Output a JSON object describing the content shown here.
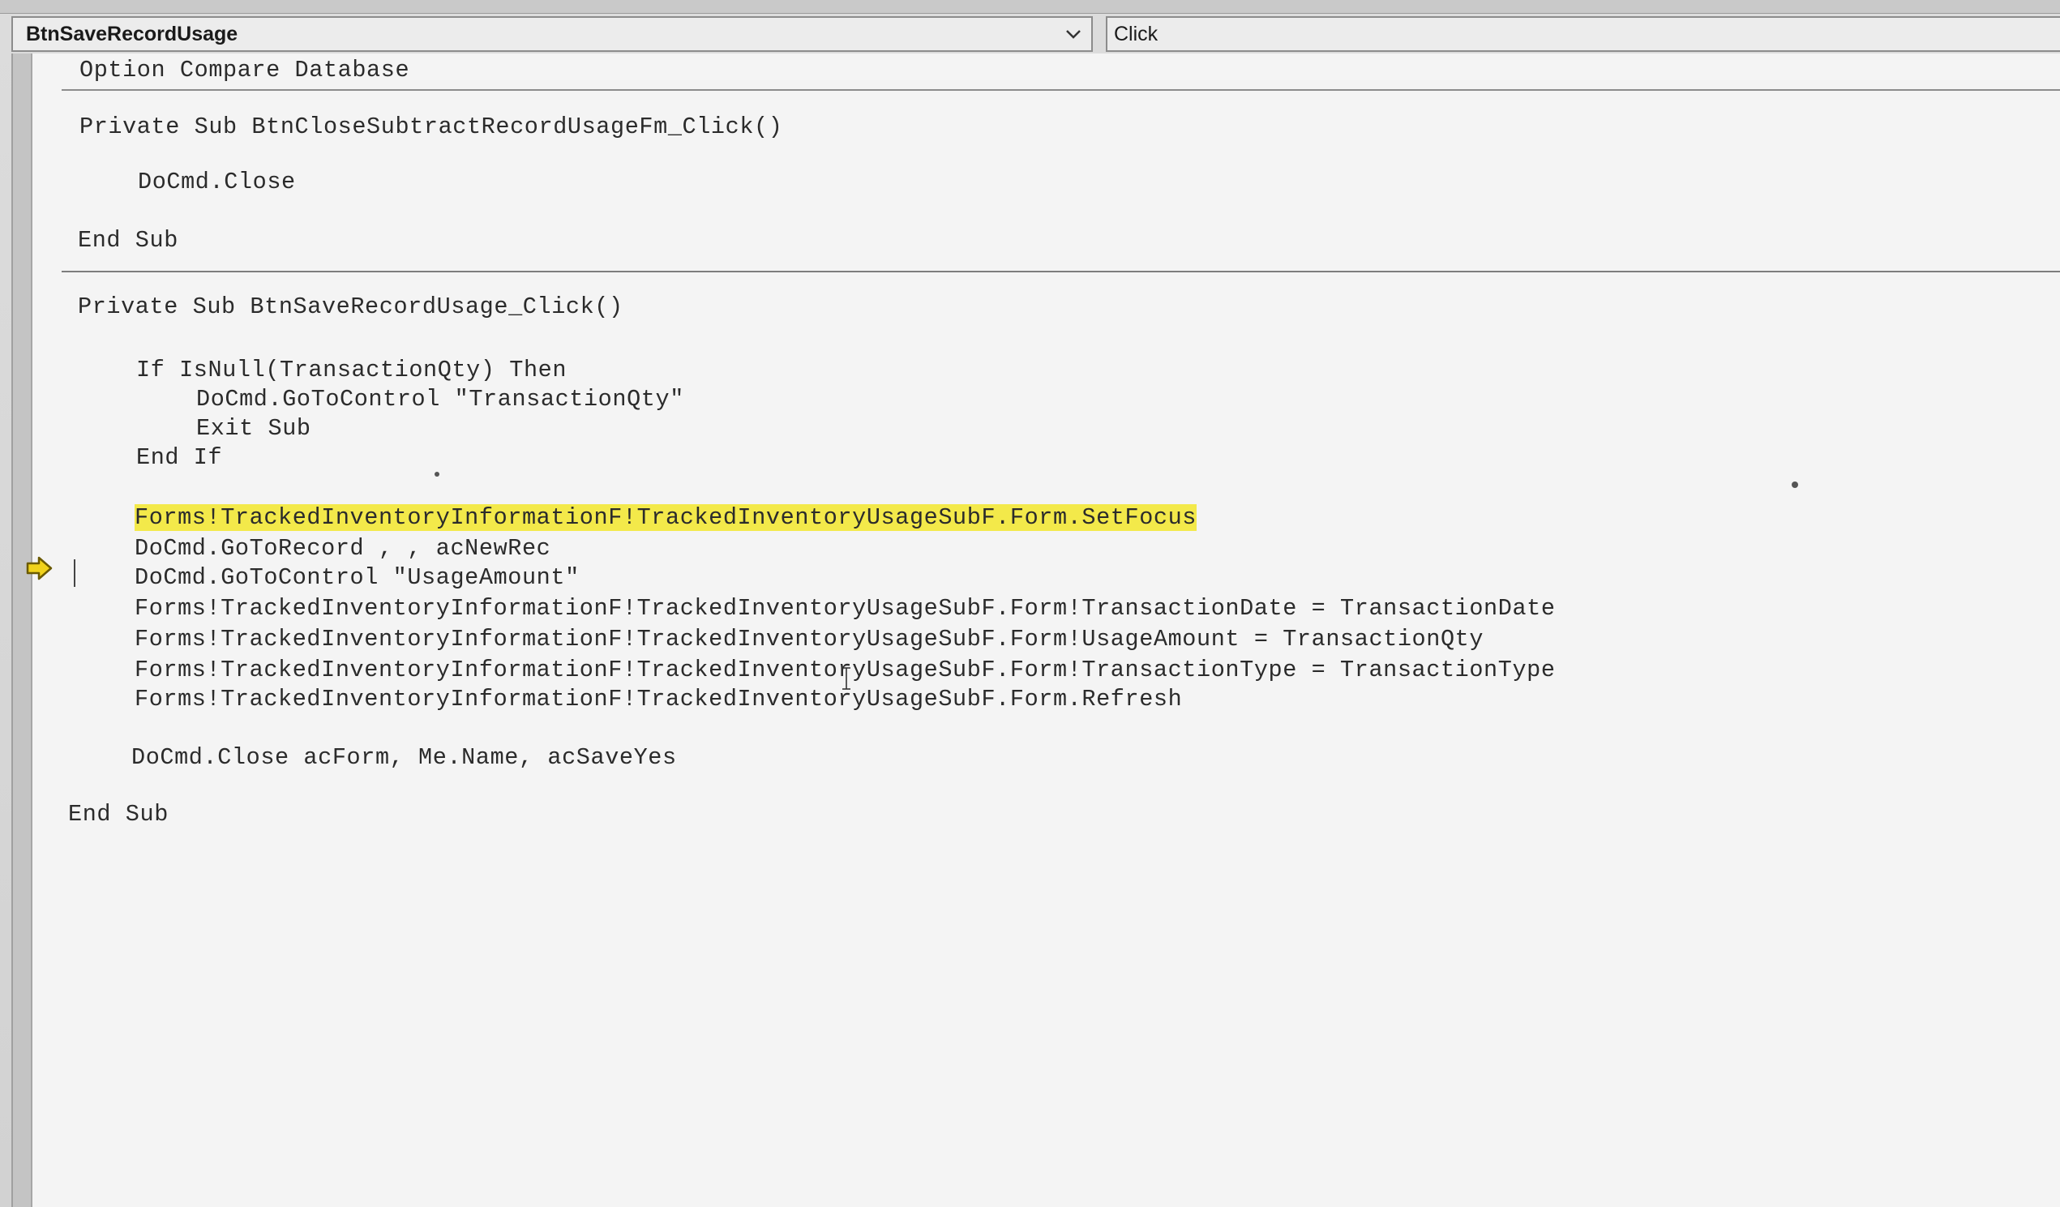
{
  "toolbar": {
    "object_combo": "BtnSaveRecordUsage",
    "procedure_combo": "Click"
  },
  "code": {
    "lines": [
      "Option Compare Database",
      "Private Sub BtnCloseSubtractRecordUsageFm_Click()",
      "DoCmd.Close",
      "End Sub",
      "Private Sub BtnSaveRecordUsage_Click()",
      "If IsNull(TransactionQty) Then",
      "DoCmd.GoToControl \"TransactionQty\"",
      "Exit Sub",
      "End If",
      "Forms!TrackedInventoryInformationF!TrackedInventoryUsageSubF.Form.SetFocus",
      "DoCmd.GoToRecord , , acNewRec",
      "DoCmd.GoToControl \"UsageAmount\"",
      "Forms!TrackedInventoryInformationF!TrackedInventoryUsageSubF.Form!TransactionDate = TransactionDate",
      "Forms!TrackedInventoryInformationF!TrackedInventoryUsageSubF.Form!UsageAmount = TransactionQty",
      "Forms!TrackedInventoryInformationF!TrackedInventoryUsageSubF.Form!TransactionType = TransactionType",
      "Forms!TrackedInventoryInformationF!TrackedInventoryUsageSubF.Form.Refresh",
      "DoCmd.Close acForm, Me.Name, acSaveYes",
      "End Sub"
    ]
  },
  "colors": {
    "highlight": "#f3e94a",
    "execution_arrow": "#f0d21c"
  },
  "icons": {
    "combo_dropdown": "chevron-down-icon",
    "execution_point": "execution-arrow-icon"
  }
}
